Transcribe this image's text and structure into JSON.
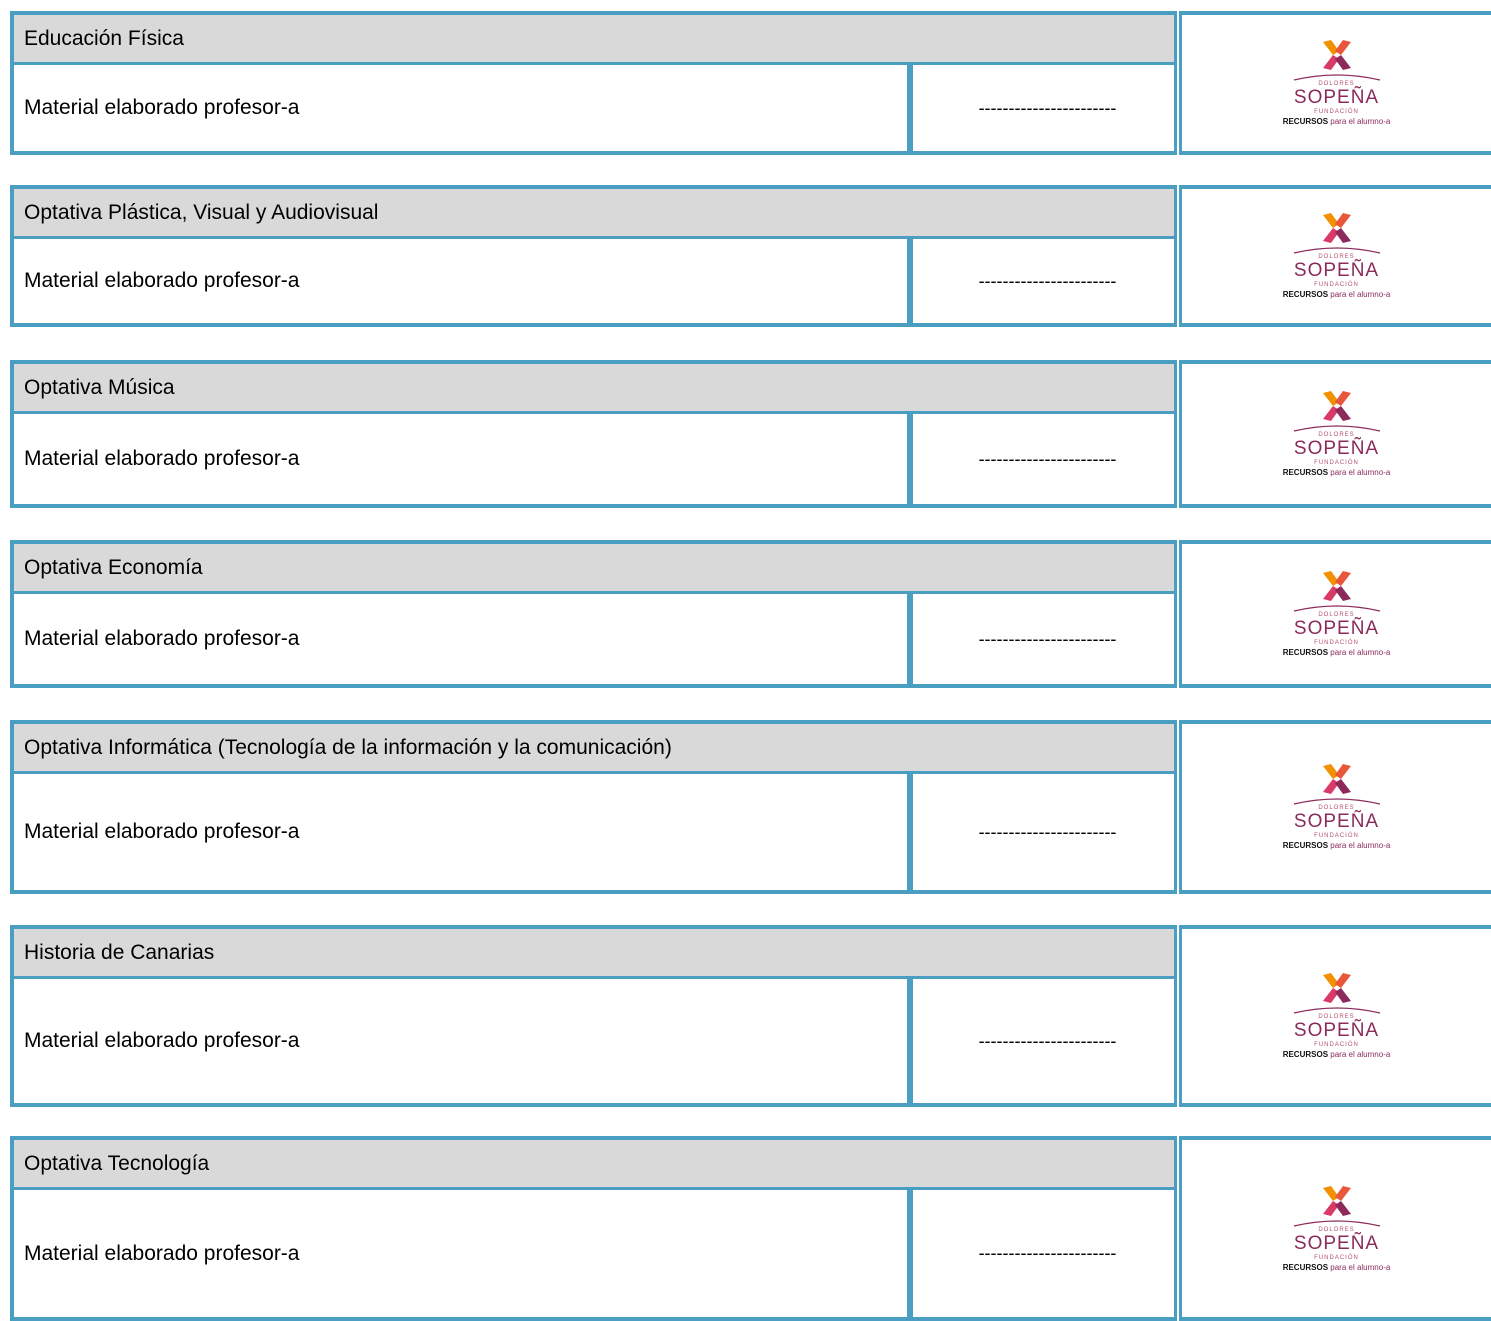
{
  "logo": {
    "small_text": "DOLORES",
    "brand": "SOPEÑA",
    "foundation": "FUNDACIÓN",
    "tagline_bold": "RECURSOS",
    "tagline_rest": "para el  alumno-a",
    "colors": [
      "#f29100",
      "#e8573b",
      "#d93a67",
      "#8b2a5b"
    ]
  },
  "sections": [
    {
      "subject": "Educación Física",
      "material": "Material elaborado profesor-a",
      "code": "-----------------------"
    },
    {
      "subject": "Optativa Plástica, Visual y Audiovisual",
      "material": "Material elaborado profesor-a",
      "code": "-----------------------"
    },
    {
      "subject": "Optativa Música",
      "material": "Material elaborado profesor-a",
      "code": "-----------------------"
    },
    {
      "subject": "Optativa Economía",
      "material": "Material elaborado profesor-a",
      "code": "-----------------------"
    },
    {
      "subject": "Optativa Informática (Tecnología de la información y la comunicación)",
      "material": "Material elaborado profesor-a",
      "code": "-----------------------"
    },
    {
      "subject": "Historia de Canarias",
      "material": "Material elaborado profesor-a",
      "code": "-----------------------"
    },
    {
      "subject": "Optativa Tecnología",
      "material": "Material elaborado profesor-a",
      "code": "-----------------------"
    }
  ]
}
